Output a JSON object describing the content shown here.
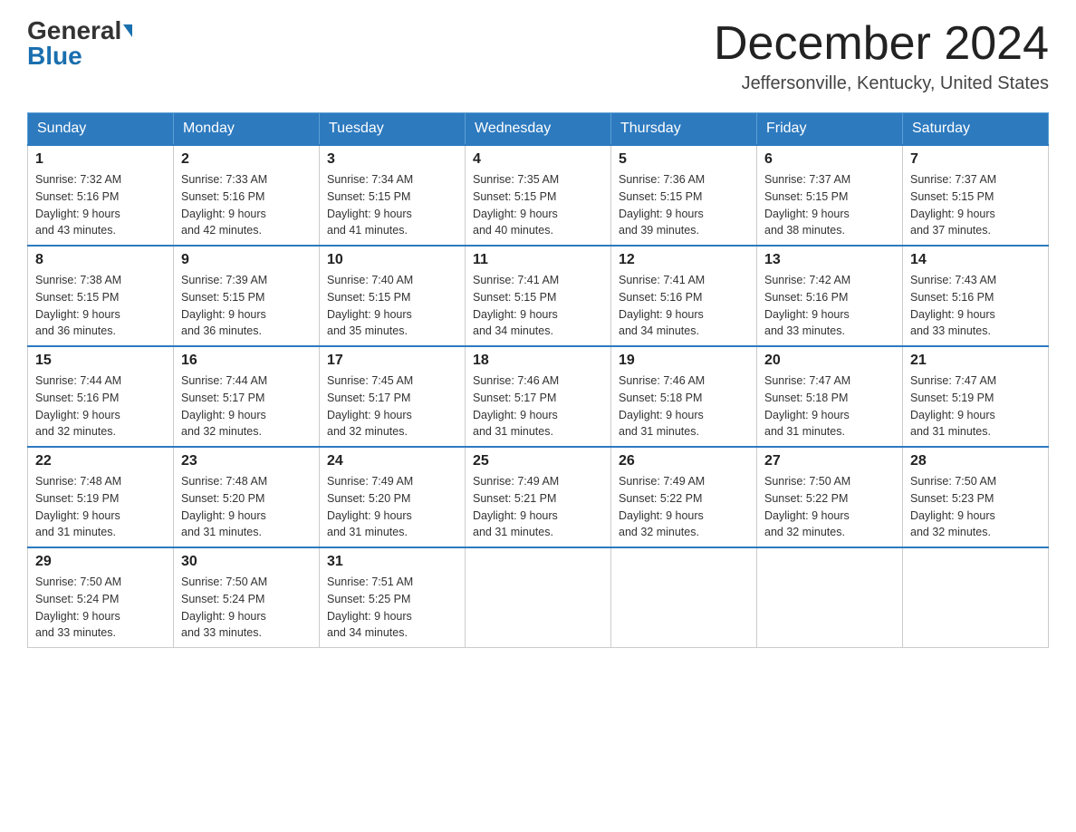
{
  "header": {
    "logo_general": "General",
    "logo_blue": "Blue",
    "month_title": "December 2024",
    "location": "Jeffersonville, Kentucky, United States"
  },
  "days_of_week": [
    "Sunday",
    "Monday",
    "Tuesday",
    "Wednesday",
    "Thursday",
    "Friday",
    "Saturday"
  ],
  "weeks": [
    [
      {
        "day": "1",
        "sunrise": "7:32 AM",
        "sunset": "5:16 PM",
        "daylight": "9 hours and 43 minutes."
      },
      {
        "day": "2",
        "sunrise": "7:33 AM",
        "sunset": "5:16 PM",
        "daylight": "9 hours and 42 minutes."
      },
      {
        "day": "3",
        "sunrise": "7:34 AM",
        "sunset": "5:15 PM",
        "daylight": "9 hours and 41 minutes."
      },
      {
        "day": "4",
        "sunrise": "7:35 AM",
        "sunset": "5:15 PM",
        "daylight": "9 hours and 40 minutes."
      },
      {
        "day": "5",
        "sunrise": "7:36 AM",
        "sunset": "5:15 PM",
        "daylight": "9 hours and 39 minutes."
      },
      {
        "day": "6",
        "sunrise": "7:37 AM",
        "sunset": "5:15 PM",
        "daylight": "9 hours and 38 minutes."
      },
      {
        "day": "7",
        "sunrise": "7:37 AM",
        "sunset": "5:15 PM",
        "daylight": "9 hours and 37 minutes."
      }
    ],
    [
      {
        "day": "8",
        "sunrise": "7:38 AM",
        "sunset": "5:15 PM",
        "daylight": "9 hours and 36 minutes."
      },
      {
        "day": "9",
        "sunrise": "7:39 AM",
        "sunset": "5:15 PM",
        "daylight": "9 hours and 36 minutes."
      },
      {
        "day": "10",
        "sunrise": "7:40 AM",
        "sunset": "5:15 PM",
        "daylight": "9 hours and 35 minutes."
      },
      {
        "day": "11",
        "sunrise": "7:41 AM",
        "sunset": "5:15 PM",
        "daylight": "9 hours and 34 minutes."
      },
      {
        "day": "12",
        "sunrise": "7:41 AM",
        "sunset": "5:16 PM",
        "daylight": "9 hours and 34 minutes."
      },
      {
        "day": "13",
        "sunrise": "7:42 AM",
        "sunset": "5:16 PM",
        "daylight": "9 hours and 33 minutes."
      },
      {
        "day": "14",
        "sunrise": "7:43 AM",
        "sunset": "5:16 PM",
        "daylight": "9 hours and 33 minutes."
      }
    ],
    [
      {
        "day": "15",
        "sunrise": "7:44 AM",
        "sunset": "5:16 PM",
        "daylight": "9 hours and 32 minutes."
      },
      {
        "day": "16",
        "sunrise": "7:44 AM",
        "sunset": "5:17 PM",
        "daylight": "9 hours and 32 minutes."
      },
      {
        "day": "17",
        "sunrise": "7:45 AM",
        "sunset": "5:17 PM",
        "daylight": "9 hours and 32 minutes."
      },
      {
        "day": "18",
        "sunrise": "7:46 AM",
        "sunset": "5:17 PM",
        "daylight": "9 hours and 31 minutes."
      },
      {
        "day": "19",
        "sunrise": "7:46 AM",
        "sunset": "5:18 PM",
        "daylight": "9 hours and 31 minutes."
      },
      {
        "day": "20",
        "sunrise": "7:47 AM",
        "sunset": "5:18 PM",
        "daylight": "9 hours and 31 minutes."
      },
      {
        "day": "21",
        "sunrise": "7:47 AM",
        "sunset": "5:19 PM",
        "daylight": "9 hours and 31 minutes."
      }
    ],
    [
      {
        "day": "22",
        "sunrise": "7:48 AM",
        "sunset": "5:19 PM",
        "daylight": "9 hours and 31 minutes."
      },
      {
        "day": "23",
        "sunrise": "7:48 AM",
        "sunset": "5:20 PM",
        "daylight": "9 hours and 31 minutes."
      },
      {
        "day": "24",
        "sunrise": "7:49 AM",
        "sunset": "5:20 PM",
        "daylight": "9 hours and 31 minutes."
      },
      {
        "day": "25",
        "sunrise": "7:49 AM",
        "sunset": "5:21 PM",
        "daylight": "9 hours and 31 minutes."
      },
      {
        "day": "26",
        "sunrise": "7:49 AM",
        "sunset": "5:22 PM",
        "daylight": "9 hours and 32 minutes."
      },
      {
        "day": "27",
        "sunrise": "7:50 AM",
        "sunset": "5:22 PM",
        "daylight": "9 hours and 32 minutes."
      },
      {
        "day": "28",
        "sunrise": "7:50 AM",
        "sunset": "5:23 PM",
        "daylight": "9 hours and 32 minutes."
      }
    ],
    [
      {
        "day": "29",
        "sunrise": "7:50 AM",
        "sunset": "5:24 PM",
        "daylight": "9 hours and 33 minutes."
      },
      {
        "day": "30",
        "sunrise": "7:50 AM",
        "sunset": "5:24 PM",
        "daylight": "9 hours and 33 minutes."
      },
      {
        "day": "31",
        "sunrise": "7:51 AM",
        "sunset": "5:25 PM",
        "daylight": "9 hours and 34 minutes."
      },
      null,
      null,
      null,
      null
    ]
  ],
  "labels": {
    "sunrise": "Sunrise:",
    "sunset": "Sunset:",
    "daylight": "Daylight:"
  }
}
